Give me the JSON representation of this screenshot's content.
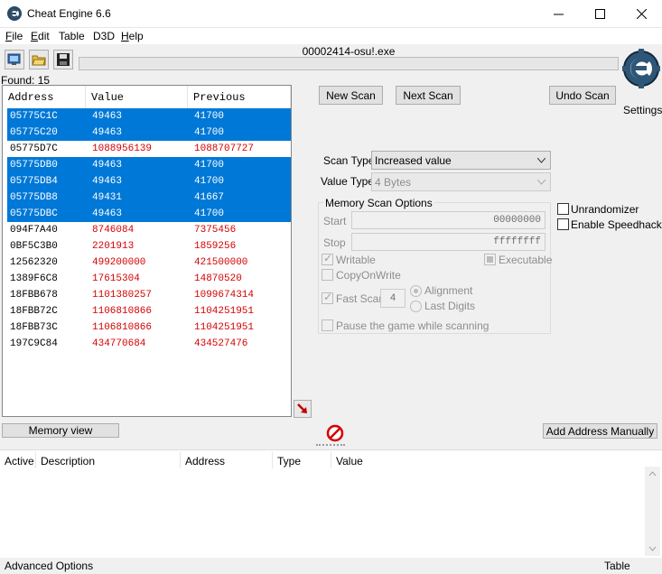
{
  "window": {
    "title": "Cheat Engine 6.6",
    "app_icon": "cheat-engine-icon",
    "controls": [
      "minimize-icon",
      "maximize-icon",
      "close-icon"
    ]
  },
  "menu": [
    {
      "label": "File",
      "u": "F",
      "rest": "ile"
    },
    {
      "label": "Edit",
      "u": "E",
      "rest": "dit"
    },
    {
      "label": "Table",
      "u": "",
      "rest": "Table"
    },
    {
      "label": "D3D",
      "u": "",
      "rest": "D3D"
    },
    {
      "label": "Help",
      "u": "H",
      "rest": "elp"
    }
  ],
  "toolbar": {
    "icons": [
      "select-process-icon",
      "open-folder-icon",
      "save-disk-icon"
    ],
    "process_title": "00002414-osu!.exe",
    "found": "Found: 15"
  },
  "results": {
    "headers": [
      "Address",
      "Value",
      "Previous"
    ],
    "rows": [
      {
        "address": "05775C1C",
        "value": "49463",
        "previous": "41700",
        "selected": true,
        "changed": false
      },
      {
        "address": "05775C20",
        "value": "49463",
        "previous": "41700",
        "selected": true,
        "changed": false
      },
      {
        "address": "05775D7C",
        "value": "1088956139",
        "previous": "1088707727",
        "selected": false,
        "changed": true
      },
      {
        "address": "05775DB0",
        "value": "49463",
        "previous": "41700",
        "selected": true,
        "changed": false
      },
      {
        "address": "05775DB4",
        "value": "49463",
        "previous": "41700",
        "selected": true,
        "changed": false
      },
      {
        "address": "05775DB8",
        "value": "49431",
        "previous": "41667",
        "selected": true,
        "changed": false
      },
      {
        "address": "05775DBC",
        "value": "49463",
        "previous": "41700",
        "selected": true,
        "changed": false
      },
      {
        "address": "094F7A40",
        "value": "8746084",
        "previous": "7375456",
        "selected": false,
        "changed": true
      },
      {
        "address": "0BF5C3B0",
        "value": "2201913",
        "previous": "1859256",
        "selected": false,
        "changed": true
      },
      {
        "address": "12562320",
        "value": "499200000",
        "previous": "421500000",
        "selected": false,
        "changed": true
      },
      {
        "address": "1389F6C8",
        "value": "17615304",
        "previous": "14870520",
        "selected": false,
        "changed": true
      },
      {
        "address": "18FBB678",
        "value": "1101380257",
        "previous": "1099674314",
        "selected": false,
        "changed": true
      },
      {
        "address": "18FBB72C",
        "value": "1106810866",
        "previous": "1104251951",
        "selected": false,
        "changed": true
      },
      {
        "address": "18FBB73C",
        "value": "1106810866",
        "previous": "1104251951",
        "selected": false,
        "changed": true
      },
      {
        "address": "197C9C84",
        "value": "434770684",
        "previous": "434527476",
        "selected": false,
        "changed": true
      }
    ]
  },
  "scan": {
    "new_scan": "New Scan",
    "next_scan": "Next Scan",
    "undo_scan": "Undo Scan",
    "settings": "Settings",
    "scan_type_label": "Scan Type",
    "scan_type_value": "Increased value",
    "value_type_label": "Value Type",
    "value_type_value": "4 Bytes",
    "memory_options_title": "Memory Scan Options",
    "start_label": "Start",
    "start_value": "00000000",
    "stop_label": "Stop",
    "stop_value": "ffffffff",
    "writable": "Writable",
    "executable": "Executable",
    "copy_on_write": "CopyOnWrite",
    "fast_scan": "Fast Scan",
    "fast_scan_value": "4",
    "alignment": "Alignment",
    "last_digits": "Last Digits",
    "pause_game": "Pause the game while scanning",
    "unrandomizer": "Unrandomizer",
    "speedhack": "Enable Speedhack"
  },
  "bottom": {
    "memory_view": "Memory view",
    "add_address": "Add Address Manually",
    "columns": [
      "Active",
      "Description",
      "Address",
      "Type",
      "Value"
    ],
    "advanced": "Advanced Options",
    "table_extras": "Table Extras"
  },
  "colors": {
    "selection": "#0078d7",
    "changed_value": "#d40000"
  }
}
